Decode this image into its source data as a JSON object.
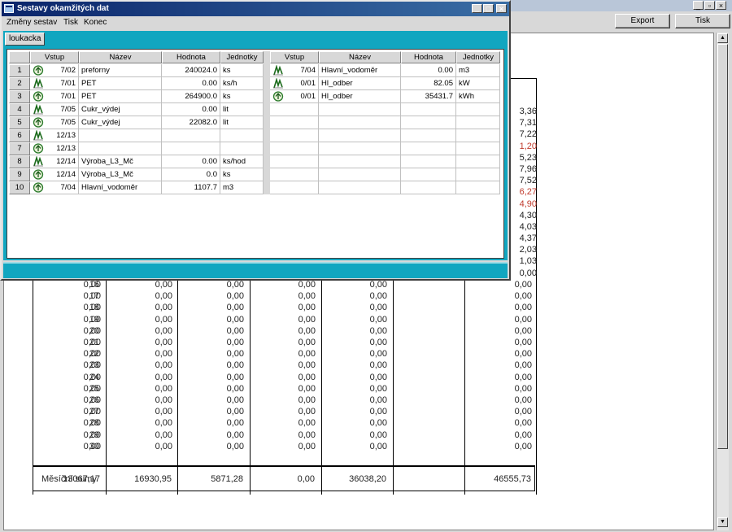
{
  "background_app": {
    "buttons": {
      "export": "Export",
      "print": "Tisk"
    },
    "right_values": [
      "3,36",
      "7,31",
      "7,22",
      "1,20",
      "5,23",
      "7,96",
      "7,52",
      "6,27",
      "4,90",
      "4,30",
      "4,03",
      "4,37",
      "2,03",
      "1,03",
      "0,00"
    ],
    "right_values_red": [
      3,
      7,
      8
    ],
    "rows": [
      {
        "day": "16",
        "values": [
          "0,00",
          "0,00",
          "0,00",
          "0,00",
          "0,00",
          "0,00"
        ]
      },
      {
        "day": "17",
        "values": [
          "0,00",
          "0,00",
          "0,00",
          "0,00",
          "0,00",
          "0,00"
        ]
      },
      {
        "day": "18",
        "values": [
          "0,00",
          "0,00",
          "0,00",
          "0,00",
          "0,00",
          "0,00"
        ]
      },
      {
        "day": "19",
        "values": [
          "0,00",
          "0,00",
          "0,00",
          "0,00",
          "0,00",
          "0,00"
        ]
      },
      {
        "day": "20",
        "values": [
          "0,00",
          "0,00",
          "0,00",
          "0,00",
          "0,00",
          "0,00"
        ]
      },
      {
        "day": "21",
        "values": [
          "0,00",
          "0,00",
          "0,00",
          "0,00",
          "0,00",
          "0,00"
        ]
      },
      {
        "day": "22",
        "values": [
          "0,00",
          "0,00",
          "0,00",
          "0,00",
          "0,00",
          "0,00"
        ]
      },
      {
        "day": "23",
        "values": [
          "0,00",
          "0,00",
          "0,00",
          "0,00",
          "0,00",
          "0,00"
        ]
      },
      {
        "day": "24",
        "values": [
          "0,00",
          "0,00",
          "0,00",
          "0,00",
          "0,00",
          "0,00"
        ]
      },
      {
        "day": "25",
        "values": [
          "0,00",
          "0,00",
          "0,00",
          "0,00",
          "0,00",
          "0,00"
        ]
      },
      {
        "day": "26",
        "values": [
          "0,00",
          "0,00",
          "0,00",
          "0,00",
          "0,00",
          "0,00"
        ]
      },
      {
        "day": "27",
        "values": [
          "0,00",
          "0,00",
          "0,00",
          "0,00",
          "0,00",
          "0,00"
        ]
      },
      {
        "day": "28",
        "values": [
          "0,00",
          "0,00",
          "0,00",
          "0,00",
          "0,00",
          "0,00"
        ]
      },
      {
        "day": "29",
        "values": [
          "0,00",
          "0,00",
          "0,00",
          "0,00",
          "0,00",
          "0,00"
        ]
      },
      {
        "day": "30",
        "values": [
          "0,00",
          "0,00",
          "0,00",
          "0,00",
          "0,00",
          "0,00"
        ]
      }
    ],
    "sums": {
      "label": "Měsíční sumy",
      "values": [
        "13067,17",
        "16930,95",
        "5871,28",
        "0,00",
        "36038,20",
        "46555,73"
      ]
    }
  },
  "window": {
    "title": "Sestavy okamžitých dat",
    "menu": [
      "Změny sestav",
      "Tisk",
      "Konec"
    ],
    "tab": "loukacka",
    "columns": [
      "Vstup",
      "Název",
      "Hodnota",
      "Jednotky"
    ],
    "left_rows": [
      {
        "num": "1",
        "icon": "meter",
        "input": "7/02",
        "name": "preforny",
        "value": "240024.0",
        "unit": "ks"
      },
      {
        "num": "2",
        "icon": "pulse",
        "input": "7/01",
        "name": "PET",
        "value": "0.00",
        "unit": "ks/h"
      },
      {
        "num": "3",
        "icon": "meter",
        "input": "7/01",
        "name": "PET",
        "value": "264900.0",
        "unit": "ks"
      },
      {
        "num": "4",
        "icon": "pulse",
        "input": "7/05",
        "name": "Cukr_výdej",
        "value": "0.00",
        "unit": "lit"
      },
      {
        "num": "5",
        "icon": "meter",
        "input": "7/05",
        "name": "Cukr_výdej",
        "value": "22082.0",
        "unit": "lit"
      },
      {
        "num": "6",
        "icon": "pulse",
        "input": "12/13",
        "name": "",
        "value": "",
        "unit": ""
      },
      {
        "num": "7",
        "icon": "meter",
        "input": "12/13",
        "name": "",
        "value": "",
        "unit": ""
      },
      {
        "num": "8",
        "icon": "pulse",
        "input": "12/14",
        "name": "Výroba_L3_Mč",
        "value": "0.00",
        "unit": "ks/hod"
      },
      {
        "num": "9",
        "icon": "meter",
        "input": "12/14",
        "name": "Výroba_L3_Mč",
        "value": "0.0",
        "unit": "ks"
      },
      {
        "num": "10",
        "icon": "meter",
        "input": "7/04",
        "name": "Hlavní_vodoměr",
        "value": "1107.7",
        "unit": "m3"
      }
    ],
    "right_rows": [
      {
        "icon": "pulse",
        "input": "7/04",
        "name": "Hlavní_vodoměr",
        "value": "0.00",
        "unit": "m3"
      },
      {
        "icon": "pulse",
        "input": "0/01",
        "name": "Hl_odber",
        "value": "82.05",
        "unit": "kW"
      },
      {
        "icon": "meter",
        "input": "0/01",
        "name": "Hl_odber",
        "value": "35431.7",
        "unit": "kWh"
      }
    ]
  }
}
